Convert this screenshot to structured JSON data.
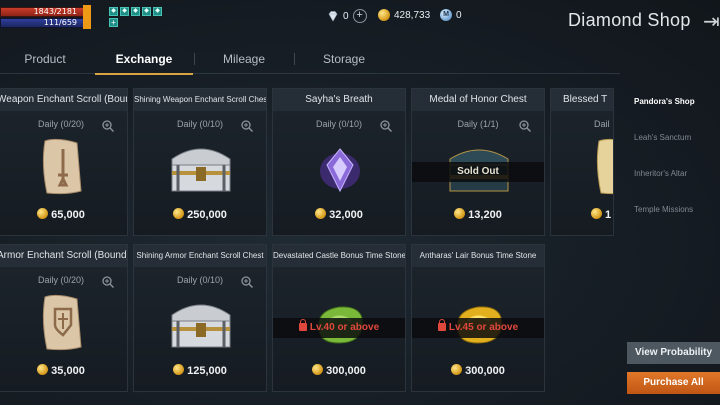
{
  "status": {
    "hp": "1843/2181",
    "mp": "111/659",
    "buff_icons": [
      "buff-icon-1",
      "buff-icon-2",
      "buff-icon-3",
      "buff-icon-4",
      "buff-icon-5"
    ],
    "buff_add_icon": "plus-icon",
    "hp_color": "#c93b2a",
    "mp_color": "#2f3f9c"
  },
  "currencies": {
    "diamond": "0",
    "gold": "428,733",
    "mileage": "0",
    "mileage_symbol": "M"
  },
  "header": {
    "title": "Diamond Shop",
    "back_icon": "arrow-right-icon"
  },
  "tabs": [
    {
      "label": "Product"
    },
    {
      "label": "Exchange",
      "active": true
    },
    {
      "label": "Mileage"
    },
    {
      "label": "Storage"
    }
  ],
  "items": [
    {
      "title": "Weapon Enchant Scroll (Bound)",
      "limit": "Daily (0/20)",
      "price": "65,000",
      "icon": "weapon-scroll-icon"
    },
    {
      "title": "Shining Weapon Enchant Scroll Chest",
      "limit": "Daily (0/10)",
      "price": "250,000",
      "icon": "chest-icon"
    },
    {
      "title": "Sayha's Breath",
      "limit": "Daily (0/10)",
      "price": "32,000",
      "icon": "crystal-icon"
    },
    {
      "title": "Medal of Honor Chest",
      "limit": "Daily (1/1)",
      "price": "13,200",
      "icon": "medal-chest-icon",
      "overlay": "Sold Out"
    },
    {
      "title": "Blessed T",
      "limit": "Dail",
      "price": "1",
      "icon": "blessed-scroll-icon"
    },
    {
      "title": "Armor Enchant Scroll (Bound)",
      "limit": "Daily (0/20)",
      "price": "35,000",
      "icon": "armor-scroll-icon"
    },
    {
      "title": "Shining Armor Enchant Scroll Chest",
      "limit": "Daily (0/10)",
      "price": "125,000",
      "icon": "chest-icon"
    },
    {
      "title": "Devastated Castle Bonus Time Stone",
      "limit": "",
      "price": "300,000",
      "icon": "green-stone-icon",
      "overlay": "Lv.40 or above"
    },
    {
      "title": "Antharas' Lair Bonus Time Stone",
      "limit": "",
      "price": "300,000",
      "icon": "gold-stone-icon",
      "overlay": "Lv.45 or above"
    }
  ],
  "sidebar": {
    "items": [
      {
        "label": "Pandora's Shop",
        "active": true
      },
      {
        "label": "Leah's Sanctum"
      },
      {
        "label": "Inheritor's Altar"
      },
      {
        "label": "Temple Missions"
      }
    ]
  },
  "buttons": {
    "view_probability": "View Probability",
    "purchase_all": "Purchase All"
  },
  "colors": {
    "accent_gold": "#d9a441",
    "purchase_orange": "#e0782a",
    "lock_red": "#e0483d"
  }
}
